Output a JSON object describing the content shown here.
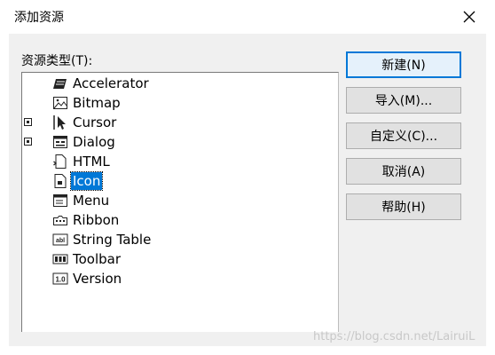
{
  "dialog": {
    "title": "添加资源",
    "resource_type_label": "资源类型(T):"
  },
  "tree": {
    "items": [
      {
        "label": "Accelerator",
        "icon": "accelerator-icon",
        "expander": false
      },
      {
        "label": "Bitmap",
        "icon": "bitmap-icon",
        "expander": false
      },
      {
        "label": "Cursor",
        "icon": "cursor-icon",
        "expander": true
      },
      {
        "label": "Dialog",
        "icon": "dialog-icon",
        "expander": true
      },
      {
        "label": "HTML",
        "icon": "html-icon",
        "expander": false
      },
      {
        "label": "Icon",
        "icon": "icon-file-icon",
        "expander": false,
        "selected": true
      },
      {
        "label": "Menu",
        "icon": "menu-icon",
        "expander": false
      },
      {
        "label": "Ribbon",
        "icon": "ribbon-icon",
        "expander": false
      },
      {
        "label": "String Table",
        "icon": "string-table-icon",
        "expander": false
      },
      {
        "label": "Toolbar",
        "icon": "toolbar-icon",
        "expander": false
      },
      {
        "label": "Version",
        "icon": "version-icon",
        "expander": false
      }
    ]
  },
  "buttons": {
    "new": "新建(N)",
    "import": "导入(M)...",
    "custom": "自定义(C)...",
    "cancel": "取消(A)",
    "help": "帮助(H)"
  },
  "watermark": "https://blog.csdn.net/LairuiL",
  "colors": {
    "selection": "#0078d7",
    "panel": "#f0f0f0",
    "button": "#e1e1e1"
  }
}
